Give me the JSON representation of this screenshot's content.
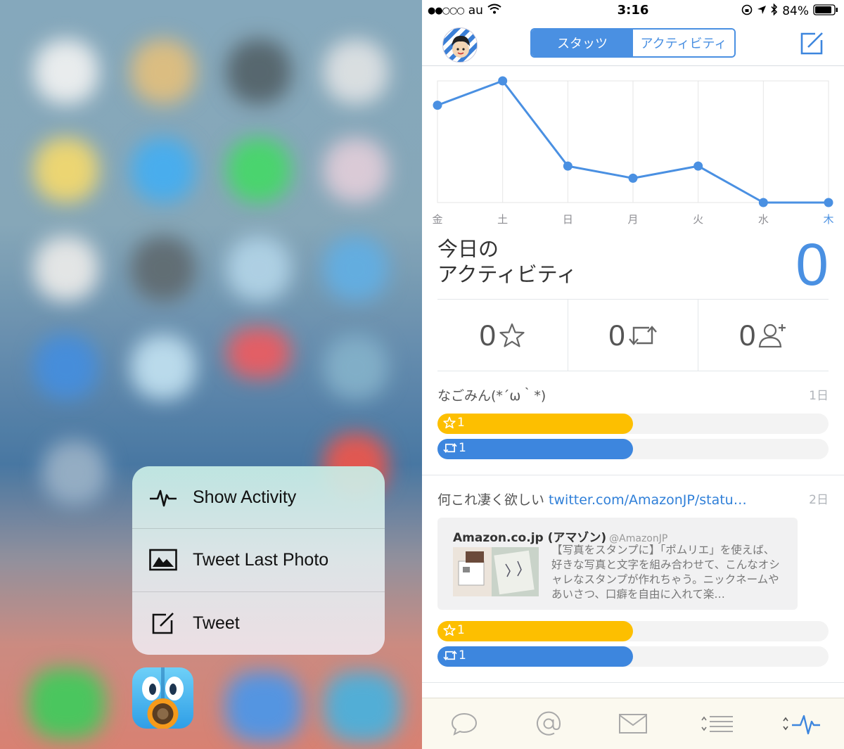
{
  "quick_actions": {
    "items": [
      {
        "label": "Show Activity",
        "icon": "activity-pulse-icon"
      },
      {
        "label": "Tweet Last Photo",
        "icon": "photo-icon"
      },
      {
        "label": "Tweet",
        "icon": "compose-icon"
      }
    ],
    "app_icon": "tweetbot-app-icon"
  },
  "status_bar": {
    "carrier": "au",
    "time": "3:16",
    "battery": "84%"
  },
  "nav": {
    "segments": [
      "スタッツ",
      "アクティビティ"
    ],
    "selected_segment": 0
  },
  "chart_data": {
    "type": "line",
    "categories": [
      "金",
      "土",
      "日",
      "月",
      "火",
      "水",
      "木"
    ],
    "values": [
      8,
      10,
      3,
      2,
      3,
      0,
      0
    ],
    "ylim": [
      0,
      10
    ],
    "grid": true,
    "highlighted_category": "木",
    "colors": {
      "line": "#4a90e2",
      "highlight_label": "#4a90e2"
    }
  },
  "today": {
    "label_line1": "今日の",
    "label_line2": "アクティビティ",
    "count": "0"
  },
  "counters": [
    {
      "value": "0",
      "icon": "star-icon"
    },
    {
      "value": "0",
      "icon": "retweet-icon"
    },
    {
      "value": "0",
      "icon": "add-follower-icon"
    }
  ],
  "activities": [
    {
      "text": "なごみん(*´ω｀*)",
      "link": "",
      "age": "1日",
      "favorites": {
        "label": "1",
        "fraction": 0.5
      },
      "retweets": {
        "label": "1",
        "fraction": 0.5
      }
    },
    {
      "text": "何これ凄く欲しい ",
      "link": "twitter.com/AmazonJP/statu…",
      "age": "2日",
      "quote": {
        "name": "Amazon.co.jp (アマゾン)",
        "handle": "@AmazonJP",
        "text": "【写真をスタンプに】「ポムリエ」を使えば、好きな写真と文字を組み合わせて、こんなオシャレなスタンプが作れちゃう。ニックネームやあいさつ、口癖を自由に入れて楽…"
      },
      "favorites": {
        "label": "1",
        "fraction": 0.5
      },
      "retweets": {
        "label": "1",
        "fraction": 0.5
      }
    }
  ],
  "tabbar": [
    "conversation-icon",
    "mentions-icon",
    "messages-icon",
    "lists-icon",
    "activity-icon"
  ],
  "colors": {
    "accent": "#4a90e2",
    "favorite": "#fdbf00",
    "retweet": "#3d86de"
  }
}
